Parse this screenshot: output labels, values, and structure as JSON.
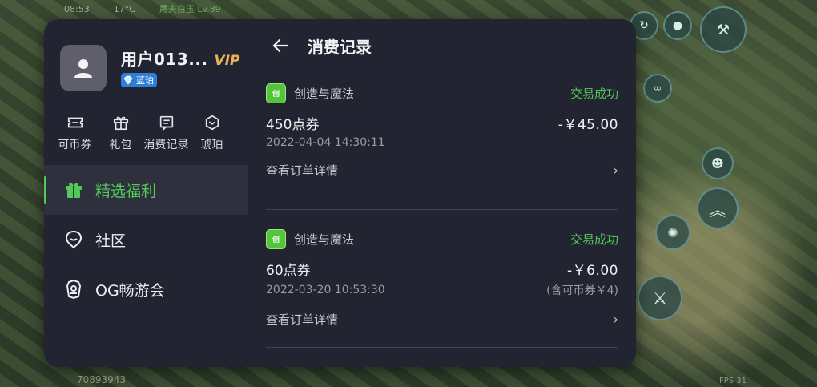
{
  "hud": {
    "time": "08:53",
    "temp": "17°C",
    "title": "屠夫白玉 Lv.89",
    "player_id": "70893943",
    "fps": "FPS 31"
  },
  "profile": {
    "username": "用户013...",
    "vip": "VIP",
    "badge": "蓝珀"
  },
  "quick_actions": [
    {
      "label": "可币券",
      "icon": "ticket-icon"
    },
    {
      "label": "礼包",
      "icon": "gift-icon"
    },
    {
      "label": "消费记录",
      "icon": "receipt-icon"
    },
    {
      "label": "琥珀",
      "icon": "amber-gem-icon"
    }
  ],
  "menu": [
    {
      "label": "精选福利",
      "icon": "gift-icon",
      "active": true
    },
    {
      "label": "社区",
      "icon": "community-chat-icon",
      "active": false
    },
    {
      "label": "OG畅游会",
      "icon": "og-club-icon",
      "active": false
    }
  ],
  "header": {
    "title": "消费记录"
  },
  "records": [
    {
      "game": "创造与魔法",
      "status": "交易成功",
      "item": "450点券",
      "amount": "-￥45.00",
      "time": "2022-04-04 14:30:11",
      "note": "",
      "detail": "查看订单详情"
    },
    {
      "game": "创造与魔法",
      "status": "交易成功",
      "item": "60点券",
      "amount": "-￥6.00",
      "time": "2022-03-20 10:53:30",
      "note": "(含可币券￥4)",
      "detail": "查看订单详情"
    }
  ],
  "colors": {
    "accent_green": "#54c95b",
    "panel_bg": "#232431",
    "vip_gold": "#e9b457",
    "badge_blue": "#2c7fd6"
  }
}
